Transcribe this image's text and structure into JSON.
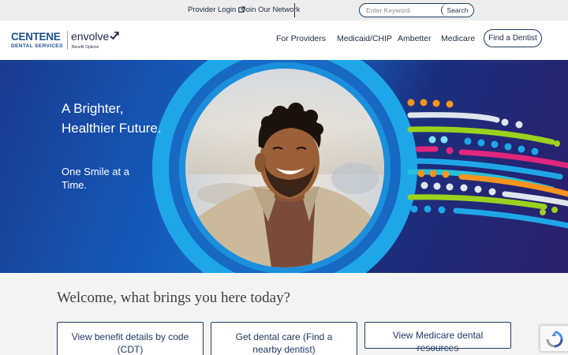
{
  "utility_bar": {
    "provider_login": "Provider Login",
    "join_network": "Join Our Network",
    "search_placeholder": "Enter Keyword",
    "search_button": "Search"
  },
  "header": {
    "logo_primary": "CENTENE",
    "logo_primary_sub": "DENTAL SERVICES",
    "logo_secondary": "envolve",
    "logo_secondary_sub": "Benefit Options",
    "nav": [
      "For Providers",
      "Medicaid/CHIP",
      "Ambetter",
      "Medicare"
    ],
    "find_dentist": "Find a Dentist"
  },
  "hero": {
    "title": "A Brighter, Healthier Future.",
    "subtitle": "One Smile at a Time.",
    "image": "smiling-man-portrait"
  },
  "welcome": {
    "title": "Welcome, what brings you here today?",
    "ctas": [
      "View benefit details by code (CDT)",
      "Get dental care (Find a nearby dentist)",
      "View Medicare dental resources"
    ]
  },
  "colors": {
    "brand_navy": "#1f3b63",
    "brand_blue": "#1d4f91",
    "ring_light_blue": "#1ea6e8",
    "accent_orange": "#f7931e",
    "accent_magenta": "#e0267d",
    "accent_green": "#9bd11e"
  },
  "icons": [
    "external-link-icon",
    "envolve-mark-icon",
    "recaptcha-icon"
  ]
}
